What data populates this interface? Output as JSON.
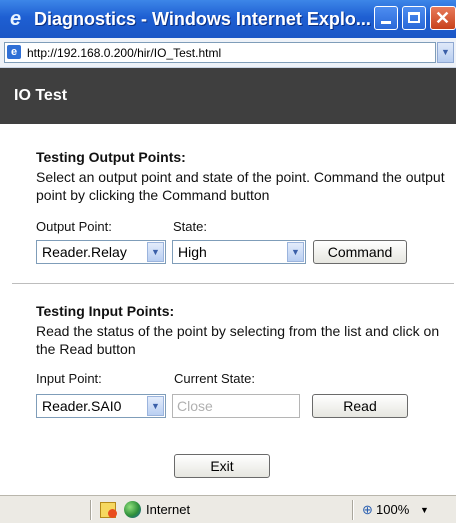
{
  "window": {
    "title": "Diagnostics - Windows Internet Explo...",
    "icon": "ie-logo-icon"
  },
  "address_bar": {
    "url": "http://192.168.0.200/hir/IO_Test.html"
  },
  "page": {
    "title": "IO Test"
  },
  "output_section": {
    "heading": "Testing Output Points:",
    "description": "Select an output point and state of the point. Command the output point by clicking the Command button",
    "output_point_label": "Output Point:",
    "output_point_value": "Reader.Relay",
    "state_label": "State:",
    "state_value": "High",
    "command_button": "Command"
  },
  "input_section": {
    "heading": "Testing Input Points:",
    "description": "Read the status of the point by selecting from the list and click on the Read button",
    "input_point_label": "Input Point:",
    "input_point_value": "Reader.SAI0",
    "current_state_label": "Current State:",
    "current_state_value": "Close",
    "read_button": "Read"
  },
  "exit_button": "Exit",
  "status_bar": {
    "zone": "Internet",
    "zoom": "100%"
  },
  "colors": {
    "titlebar": "#1e5fd2",
    "header": "#3f3f3f"
  }
}
